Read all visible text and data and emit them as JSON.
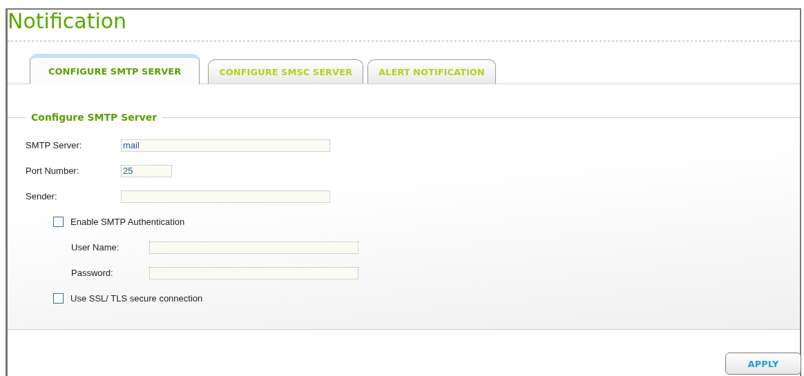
{
  "title": "Notification",
  "tabs": [
    {
      "label": "CONFIGURE SMTP SERVER",
      "selected": true
    },
    {
      "label": "CONFIGURE SMSC SERVER",
      "selected": false
    },
    {
      "label": "ALERT NOTIFICATION",
      "selected": false
    }
  ],
  "section": {
    "legend": "Configure SMTP Server",
    "items": [
      {
        "kind": "field",
        "label": "SMTP Server:",
        "value": "mail"
      },
      {
        "kind": "short-field",
        "label": "Port Number:",
        "value": "25"
      },
      {
        "kind": "field",
        "label": "Sender:"
      },
      {
        "kind": "checkbox",
        "label": "Enable SMTP Authentication",
        "checked": false,
        "children": [
          {
            "kind": "field",
            "label": "User Name:"
          },
          {
            "kind": "field",
            "label": "Password:"
          }
        ]
      },
      {
        "kind": "checkbox",
        "label": "Use SSL/ TLS secure connection",
        "checked": false
      }
    ]
  },
  "buttons": [
    "APPLY"
  ]
}
